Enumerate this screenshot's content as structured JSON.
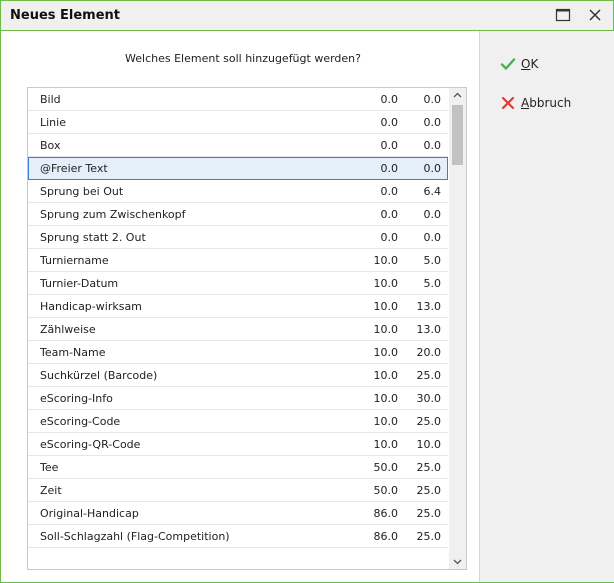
{
  "window": {
    "title": "Neues Element"
  },
  "dialog": {
    "question": "Welches Element soll hinzugefügt werden?",
    "ok_accel": "O",
    "ok_rest": "K",
    "cancel_accel": "A",
    "cancel_rest": "bbruch"
  },
  "list": {
    "selected_index": 3,
    "rows": [
      {
        "name": "Bild",
        "a": "0.0",
        "b": "0.0"
      },
      {
        "name": "Linie",
        "a": "0.0",
        "b": "0.0"
      },
      {
        "name": "Box",
        "a": "0.0",
        "b": "0.0"
      },
      {
        "name": "@Freier Text",
        "a": "0.0",
        "b": "0.0"
      },
      {
        "name": "Sprung bei Out",
        "a": "0.0",
        "b": "6.4"
      },
      {
        "name": "Sprung zum Zwischenkopf",
        "a": "0.0",
        "b": "0.0"
      },
      {
        "name": "Sprung statt 2. Out",
        "a": "0.0",
        "b": "0.0"
      },
      {
        "name": "Turniername",
        "a": "10.0",
        "b": "5.0"
      },
      {
        "name": "Turnier-Datum",
        "a": "10.0",
        "b": "5.0"
      },
      {
        "name": "Handicap-wirksam",
        "a": "10.0",
        "b": "13.0"
      },
      {
        "name": "Zählweise",
        "a": "10.0",
        "b": "13.0"
      },
      {
        "name": "Team-Name",
        "a": "10.0",
        "b": "20.0"
      },
      {
        "name": "Suchkürzel (Barcode)",
        "a": "10.0",
        "b": "25.0"
      },
      {
        "name": "eScoring-Info",
        "a": "10.0",
        "b": "30.0"
      },
      {
        "name": "eScoring-Code",
        "a": "10.0",
        "b": "25.0"
      },
      {
        "name": "eScoring-QR-Code",
        "a": "10.0",
        "b": "10.0"
      },
      {
        "name": "Tee",
        "a": "50.0",
        "b": "25.0"
      },
      {
        "name": "Zeit",
        "a": "50.0",
        "b": "25.0"
      },
      {
        "name": "Original-Handicap",
        "a": "86.0",
        "b": "25.0"
      },
      {
        "name": "Soll-Schlagzahl (Flag-Competition)",
        "a": "86.0",
        "b": "25.0"
      }
    ]
  },
  "colors": {
    "accent_border": "#6dbb44",
    "ok_icon": "#4caf50",
    "cancel_icon": "#e53935",
    "selection_border": "#3c7fd4"
  },
  "icons": {
    "maximize": "maximize-icon",
    "close": "close-icon",
    "ok": "checkmark-icon",
    "cancel": "x-icon",
    "scroll_up": "chevron-up-icon",
    "scroll_down": "chevron-down-icon"
  }
}
